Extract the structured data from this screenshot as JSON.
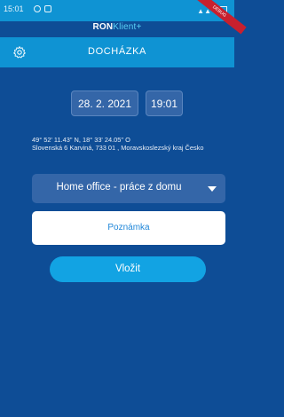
{
  "status_bar": {
    "time": "15:01"
  },
  "brand": {
    "part1": "RON",
    "part2": "Klient+"
  },
  "ribbon": {
    "label": "DEBUG"
  },
  "app_bar": {
    "title": "DOCHÁZKA",
    "settings_icon": "gear-icon"
  },
  "datetime": {
    "date": "28. 2. 2021",
    "time": "19:01"
  },
  "location": {
    "coords": "49° 52' 11.43\" N, 18° 33' 24.05\" O",
    "address": "Slovenská 6 Karviná, 733 01 , Moravskoslezský kraj Česko"
  },
  "attendance_type": {
    "selected": "Home office - práce z domu"
  },
  "note": {
    "placeholder": "Poznámka"
  },
  "submit": {
    "label": "Vložit"
  },
  "colors": {
    "background": "#0e4d96",
    "accent": "#0f93d3",
    "button": "#12a3e3",
    "chip": "#3466a8"
  }
}
